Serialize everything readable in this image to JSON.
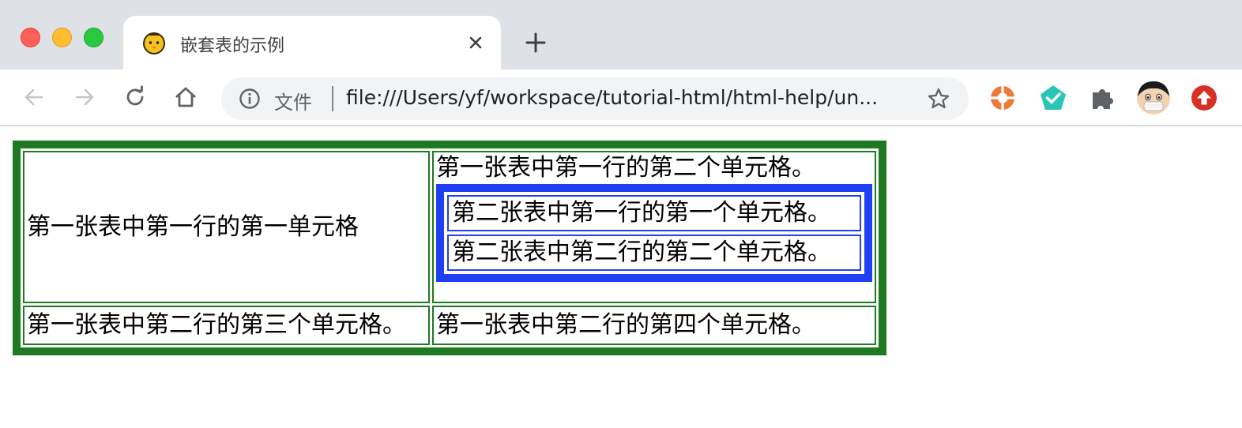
{
  "browser": {
    "tab": {
      "title": "嵌套表的示例",
      "favicon": "chick-icon"
    },
    "omnibox": {
      "scheme_label": "文件",
      "url": "file:///Users/yf/workspace/tutorial-html/html-help/un..."
    },
    "extensions": [
      "lifebuoy-icon",
      "pentagon-check-icon",
      "puzzle-icon",
      "avatar",
      "upload-arrow-icon"
    ]
  },
  "page": {
    "outer_table": {
      "r1c1": "第一张表中第一行的第一单元格",
      "r1c2": "第一张表中第一行的第二个单元格。",
      "r2c1": "第一张表中第二行的第三个单元格。",
      "r2c2": "第一张表中第二行的第四个单元格。"
    },
    "inner_table": {
      "r1": "第二张表中第一行的第一个单元格。",
      "r2": "第二张表中第二行的第二个单元格。"
    },
    "colors": {
      "outer_border": "#1e7a20",
      "inner_border": "#1f3ff5"
    }
  }
}
